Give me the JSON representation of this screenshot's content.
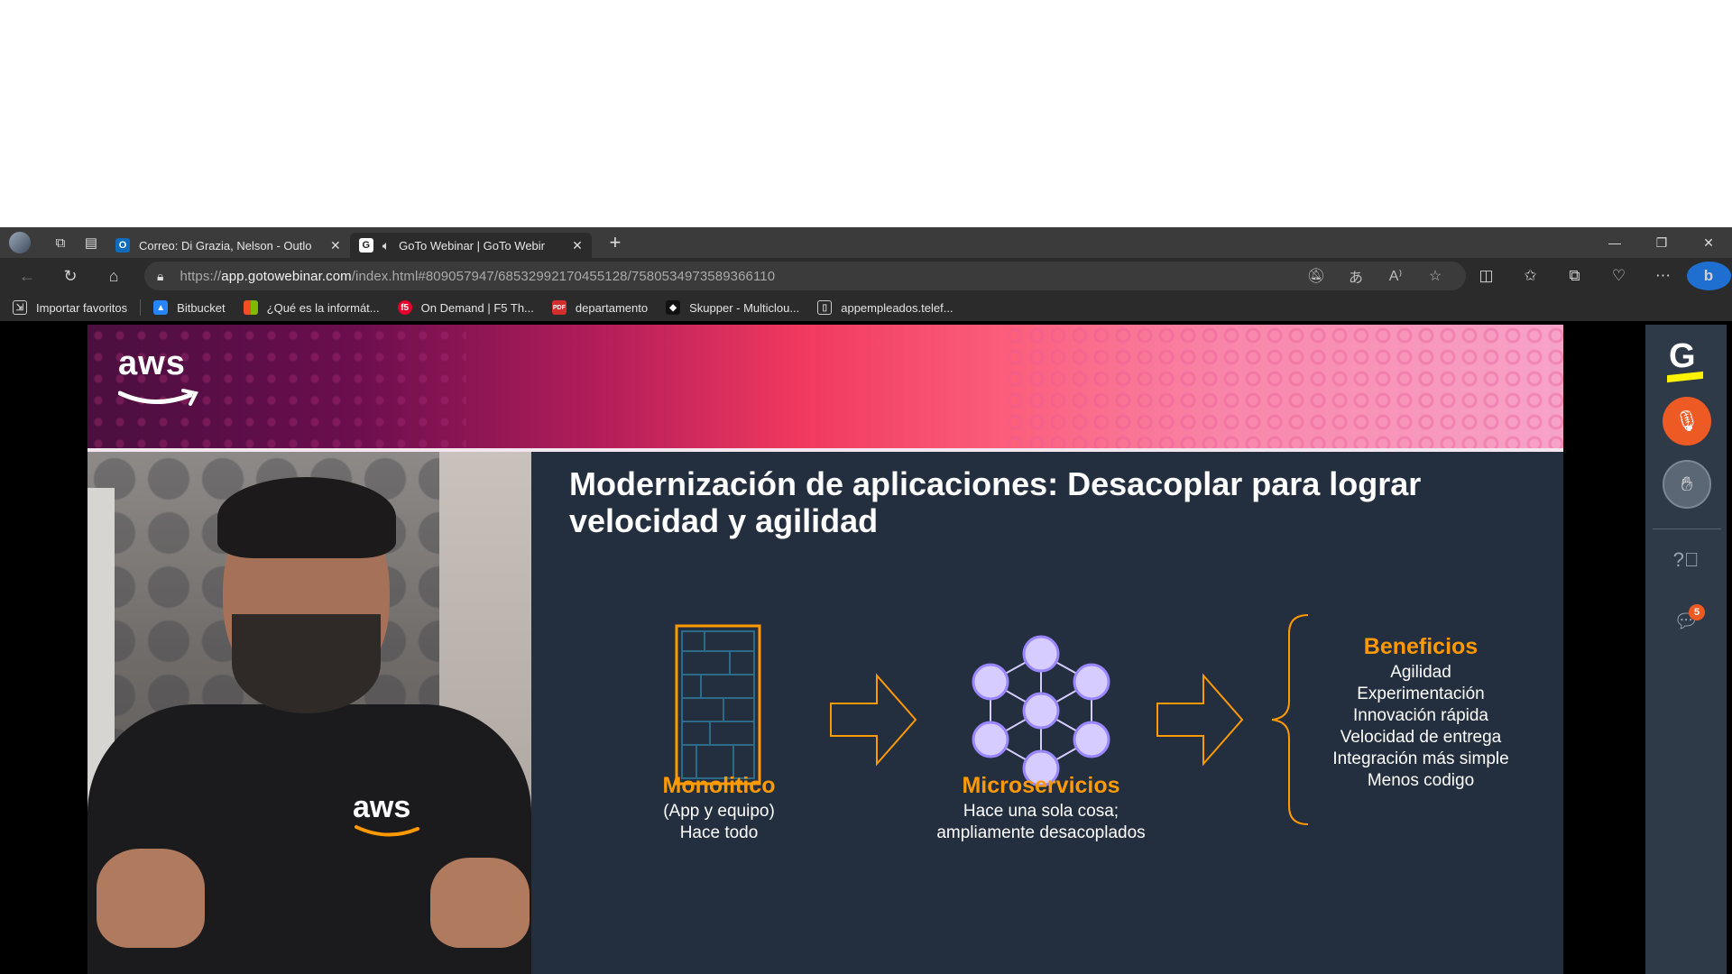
{
  "browser": {
    "tabs": [
      {
        "title": "Correo: Di Grazia, Nelson - Outlo",
        "favicon": "outlook-icon",
        "active": false
      },
      {
        "title": "GoTo Webinar | GoTo Webir",
        "favicon": "goto-icon",
        "active": true
      }
    ],
    "url": {
      "scheme": "https://",
      "host": "app.gotowebinar.com",
      "path": "/index.html#809057947/68532992170455128/7580534973589366110"
    },
    "bookmarks": [
      {
        "label": "Importar favoritos",
        "icon": "import-icon"
      },
      {
        "label": "Bitbucket",
        "icon": "bitbucket-icon"
      },
      {
        "label": "¿Qué es la informát...",
        "icon": "microsoft-icon"
      },
      {
        "label": "On Demand | F5 Th...",
        "icon": "f5-icon"
      },
      {
        "label": "departamento",
        "icon": "pdf-icon"
      },
      {
        "label": "Skupper - Multiclou...",
        "icon": "skupper-icon"
      },
      {
        "label": "appempleados.telef...",
        "icon": "page-icon"
      }
    ]
  },
  "slide": {
    "logo_text": "aws",
    "title": "Modernización de aplicaciones: Desacoplar para lograr velocidad y agilidad",
    "monolith": {
      "label": "Monolitico",
      "sub1": "(App y equipo)",
      "sub2": "Hace todo"
    },
    "micro": {
      "label": "Microservicios",
      "sub1": "Hace una sola cosa;",
      "sub2": "ampliamente desacoplados"
    },
    "benefits": {
      "title": "Beneficios",
      "items": [
        "Agilidad",
        "Experimentación",
        "Innovación rápida",
        "Velocidad de entrega",
        "Integración más simple",
        "Menos codigo"
      ]
    },
    "shirt_logo": "aws",
    "accent_color": "#ff9900",
    "node_color": "#d7ccff"
  },
  "sidebar": {
    "logo": "G",
    "chat_badge": "5"
  }
}
